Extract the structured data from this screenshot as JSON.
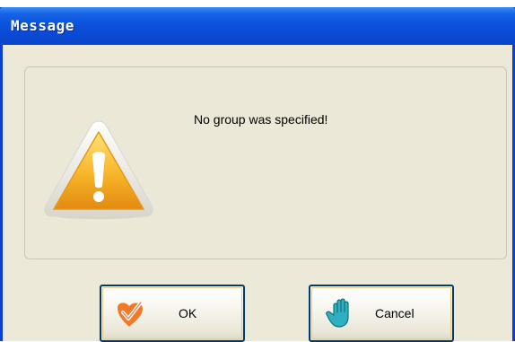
{
  "window": {
    "title": "Message",
    "title_color": "#ffffff",
    "titlebar_color": "#0a52dc",
    "background_color": "#ece9d8"
  },
  "content": {
    "icon": "warning-triangle-icon",
    "message": "No group was specified!"
  },
  "buttons": {
    "ok": {
      "label": "OK",
      "icon": "checkmark-icon"
    },
    "cancel": {
      "label": "Cancel",
      "icon": "hand-stop-icon"
    }
  }
}
